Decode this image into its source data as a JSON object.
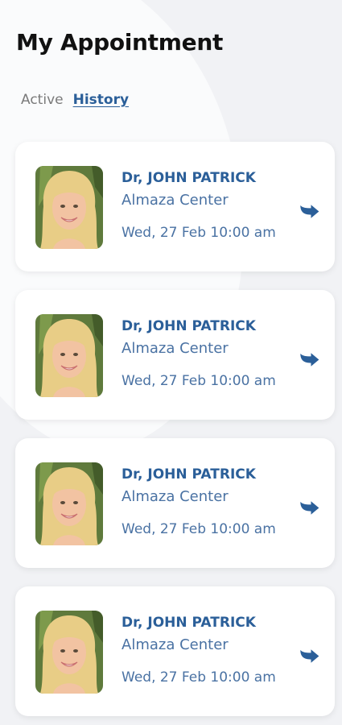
{
  "page": {
    "title": "My Appointment",
    "tabs": [
      {
        "label": "Active"
      },
      {
        "label": "History"
      }
    ]
  },
  "colors": {
    "accent": "#2b5f99",
    "secondary_text": "#4a72a3",
    "background": "#f1f2f5",
    "card": "#ffffff"
  },
  "appointments": [
    {
      "doctor": "Dr, JOHN PATRICK",
      "center": "Almaza Center",
      "datetime": "Wed, 27 Feb 10:00 am",
      "action_icon": "share-arrow-icon"
    },
    {
      "doctor": "Dr, JOHN PATRICK",
      "center": "Almaza Center",
      "datetime": "Wed, 27 Feb 10:00 am",
      "action_icon": "share-arrow-icon"
    },
    {
      "doctor": "Dr, JOHN PATRICK",
      "center": "Almaza Center",
      "datetime": "Wed, 27 Feb 10:00 am",
      "action_icon": "share-arrow-icon"
    },
    {
      "doctor": "Dr, JOHN PATRICK",
      "center": "Almaza Center",
      "datetime": "Wed, 27 Feb 10:00 am",
      "action_icon": "share-arrow-icon"
    }
  ]
}
